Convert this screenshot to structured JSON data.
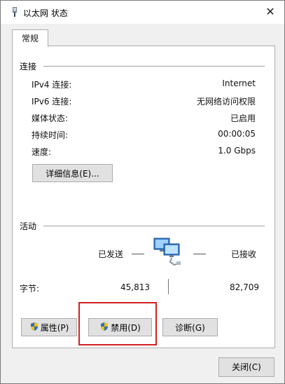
{
  "window": {
    "title": "以太网 状态",
    "close_glyph": "✕"
  },
  "tabs": [
    {
      "label": "常规",
      "selected": true
    }
  ],
  "connection": {
    "heading": "连接",
    "rows": [
      {
        "label": "IPv4 连接:",
        "value": "Internet"
      },
      {
        "label": "IPv6 连接:",
        "value": "无网络访问权限"
      },
      {
        "label": "媒体状态:",
        "value": "已启用"
      },
      {
        "label": "持续时间:",
        "value": "00:00:05"
      },
      {
        "label": "速度:",
        "value": "1.0 Gbps"
      }
    ],
    "details_button": "详细信息(E)..."
  },
  "activity": {
    "heading": "活动",
    "sent_label": "已发送",
    "received_label": "已接收",
    "bytes_label": "字节:",
    "bytes_sent": "45,813",
    "bytes_received": "82,709"
  },
  "buttons": {
    "properties": "属性(P)",
    "disable": "禁用(D)",
    "diagnose": "诊断(G)",
    "close": "关闭(C)"
  },
  "colors": {
    "highlight_box": "#d22020",
    "shield_blue": "#2a6fc9",
    "shield_yellow": "#f2c200"
  },
  "icons": {
    "title": "network-adapter-icon",
    "activity": "network-computers-icon",
    "uac": "uac-shield-icon"
  }
}
